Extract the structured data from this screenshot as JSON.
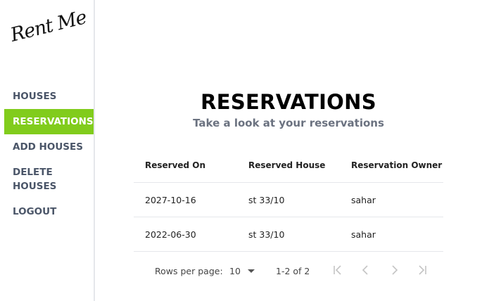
{
  "brand": {
    "logo_text": "Rent Me"
  },
  "sidebar": {
    "items": [
      {
        "label": "HOUSES"
      },
      {
        "label": "RESERVATIONS"
      },
      {
        "label": "ADD HOUSES"
      },
      {
        "label": "DELETE HOUSES"
      },
      {
        "label": "LOGOUT"
      }
    ],
    "active_color": "#81cc1c"
  },
  "main": {
    "title": "RESERVATIONS",
    "subtitle": "Take a look at your reservations"
  },
  "table": {
    "headers": [
      "Reserved On",
      "Reserved House",
      "Reservation Owner"
    ],
    "rows": [
      [
        "2027-10-16",
        "st 33/10",
        "sahar"
      ],
      [
        "2022-06-30",
        "st 33/10",
        "sahar"
      ]
    ]
  },
  "pagination": {
    "rows_per_page_label": "Rows per page:",
    "rows_per_page_value": "10",
    "range": "1-2 of 2"
  }
}
